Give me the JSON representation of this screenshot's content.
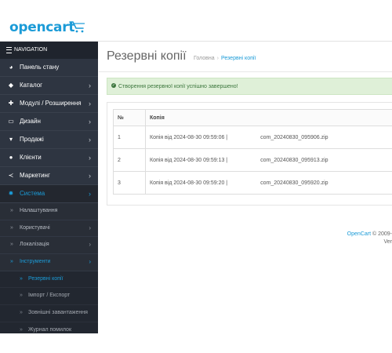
{
  "brand": {
    "logo_text": "opencart"
  },
  "sidebar": {
    "nav_header": "NAVIGATION",
    "items": [
      {
        "label": "Панель стану",
        "icon": "dashboard-icon",
        "glyph": "◕",
        "has_children": false
      },
      {
        "label": "Каталог",
        "icon": "tag-icon",
        "glyph": "◆",
        "has_children": true
      },
      {
        "label": "Модулі / Розширення",
        "icon": "puzzle-icon",
        "glyph": "✚",
        "has_children": true
      },
      {
        "label": "Дизайн",
        "icon": "monitor-icon",
        "glyph": "▭",
        "has_children": true
      },
      {
        "label": "Продажі",
        "icon": "shopping-cart-icon",
        "glyph": "▾",
        "has_children": true
      },
      {
        "label": "Клієнти",
        "icon": "user-icon",
        "glyph": "●",
        "has_children": true
      },
      {
        "label": "Маркетинг",
        "icon": "share-icon",
        "glyph": "≺",
        "has_children": true
      },
      {
        "label": "Система",
        "icon": "gear-icon",
        "glyph": "✹",
        "has_children": true,
        "active": true
      }
    ],
    "system_sub": [
      {
        "label": "Налаштування",
        "has_children": false
      },
      {
        "label": "Користувачі",
        "has_children": true
      },
      {
        "label": "Локалізація",
        "has_children": true
      },
      {
        "label": "Інструменти",
        "has_children": true,
        "open": true
      }
    ],
    "tools_sub": [
      {
        "label": "Резервні копії",
        "current": true
      },
      {
        "label": "Імпорт / Експорт"
      },
      {
        "label": "Зовнішні завантаження"
      },
      {
        "label": "Журнал помилок"
      }
    ]
  },
  "page": {
    "title": "Резервні копії",
    "breadcrumb": {
      "home": "Головна",
      "separator": "›",
      "current": "Резервні копії"
    },
    "alert": "Створення резервної копії успішно завершено!"
  },
  "table": {
    "headers": [
      "№",
      "Копія"
    ],
    "rows": [
      {
        "num": "1",
        "copy": "Копія від 2024-08-30 09:59:06 |",
        "file": "com_20240830_095906.zip"
      },
      {
        "num": "2",
        "copy": "Копія від 2024-08-30 09:59:13 |",
        "file": "com_20240830_095913.zip"
      },
      {
        "num": "3",
        "copy": "Копія від 2024-08-30 09:59:20 |",
        "file": "com_20240830_095920.zip"
      }
    ]
  },
  "footer": {
    "link": "OpenCart",
    "copyright": "© 2009-",
    "version": "Ver"
  },
  "colors": {
    "accent": "#1b9bd7",
    "sidebar_bg": "#2e3541",
    "success_bg": "#dff0d8",
    "success_text": "#3c763d"
  }
}
